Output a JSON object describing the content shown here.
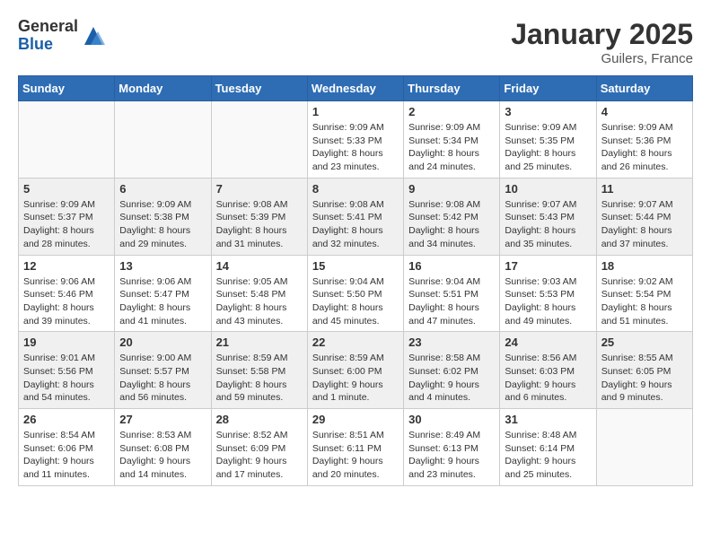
{
  "logo": {
    "general": "General",
    "blue": "Blue"
  },
  "title": "January 2025",
  "location": "Guilers, France",
  "weekdays": [
    "Sunday",
    "Monday",
    "Tuesday",
    "Wednesday",
    "Thursday",
    "Friday",
    "Saturday"
  ],
  "weeks": [
    [
      {
        "day": "",
        "info": ""
      },
      {
        "day": "",
        "info": ""
      },
      {
        "day": "",
        "info": ""
      },
      {
        "day": "1",
        "info": "Sunrise: 9:09 AM\nSunset: 5:33 PM\nDaylight: 8 hours and 23 minutes."
      },
      {
        "day": "2",
        "info": "Sunrise: 9:09 AM\nSunset: 5:34 PM\nDaylight: 8 hours and 24 minutes."
      },
      {
        "day": "3",
        "info": "Sunrise: 9:09 AM\nSunset: 5:35 PM\nDaylight: 8 hours and 25 minutes."
      },
      {
        "day": "4",
        "info": "Sunrise: 9:09 AM\nSunset: 5:36 PM\nDaylight: 8 hours and 26 minutes."
      }
    ],
    [
      {
        "day": "5",
        "info": "Sunrise: 9:09 AM\nSunset: 5:37 PM\nDaylight: 8 hours and 28 minutes."
      },
      {
        "day": "6",
        "info": "Sunrise: 9:09 AM\nSunset: 5:38 PM\nDaylight: 8 hours and 29 minutes."
      },
      {
        "day": "7",
        "info": "Sunrise: 9:08 AM\nSunset: 5:39 PM\nDaylight: 8 hours and 31 minutes."
      },
      {
        "day": "8",
        "info": "Sunrise: 9:08 AM\nSunset: 5:41 PM\nDaylight: 8 hours and 32 minutes."
      },
      {
        "day": "9",
        "info": "Sunrise: 9:08 AM\nSunset: 5:42 PM\nDaylight: 8 hours and 34 minutes."
      },
      {
        "day": "10",
        "info": "Sunrise: 9:07 AM\nSunset: 5:43 PM\nDaylight: 8 hours and 35 minutes."
      },
      {
        "day": "11",
        "info": "Sunrise: 9:07 AM\nSunset: 5:44 PM\nDaylight: 8 hours and 37 minutes."
      }
    ],
    [
      {
        "day": "12",
        "info": "Sunrise: 9:06 AM\nSunset: 5:46 PM\nDaylight: 8 hours and 39 minutes."
      },
      {
        "day": "13",
        "info": "Sunrise: 9:06 AM\nSunset: 5:47 PM\nDaylight: 8 hours and 41 minutes."
      },
      {
        "day": "14",
        "info": "Sunrise: 9:05 AM\nSunset: 5:48 PM\nDaylight: 8 hours and 43 minutes."
      },
      {
        "day": "15",
        "info": "Sunrise: 9:04 AM\nSunset: 5:50 PM\nDaylight: 8 hours and 45 minutes."
      },
      {
        "day": "16",
        "info": "Sunrise: 9:04 AM\nSunset: 5:51 PM\nDaylight: 8 hours and 47 minutes."
      },
      {
        "day": "17",
        "info": "Sunrise: 9:03 AM\nSunset: 5:53 PM\nDaylight: 8 hours and 49 minutes."
      },
      {
        "day": "18",
        "info": "Sunrise: 9:02 AM\nSunset: 5:54 PM\nDaylight: 8 hours and 51 minutes."
      }
    ],
    [
      {
        "day": "19",
        "info": "Sunrise: 9:01 AM\nSunset: 5:56 PM\nDaylight: 8 hours and 54 minutes."
      },
      {
        "day": "20",
        "info": "Sunrise: 9:00 AM\nSunset: 5:57 PM\nDaylight: 8 hours and 56 minutes."
      },
      {
        "day": "21",
        "info": "Sunrise: 8:59 AM\nSunset: 5:58 PM\nDaylight: 8 hours and 59 minutes."
      },
      {
        "day": "22",
        "info": "Sunrise: 8:59 AM\nSunset: 6:00 PM\nDaylight: 9 hours and 1 minute."
      },
      {
        "day": "23",
        "info": "Sunrise: 8:58 AM\nSunset: 6:02 PM\nDaylight: 9 hours and 4 minutes."
      },
      {
        "day": "24",
        "info": "Sunrise: 8:56 AM\nSunset: 6:03 PM\nDaylight: 9 hours and 6 minutes."
      },
      {
        "day": "25",
        "info": "Sunrise: 8:55 AM\nSunset: 6:05 PM\nDaylight: 9 hours and 9 minutes."
      }
    ],
    [
      {
        "day": "26",
        "info": "Sunrise: 8:54 AM\nSunset: 6:06 PM\nDaylight: 9 hours and 11 minutes."
      },
      {
        "day": "27",
        "info": "Sunrise: 8:53 AM\nSunset: 6:08 PM\nDaylight: 9 hours and 14 minutes."
      },
      {
        "day": "28",
        "info": "Sunrise: 8:52 AM\nSunset: 6:09 PM\nDaylight: 9 hours and 17 minutes."
      },
      {
        "day": "29",
        "info": "Sunrise: 8:51 AM\nSunset: 6:11 PM\nDaylight: 9 hours and 20 minutes."
      },
      {
        "day": "30",
        "info": "Sunrise: 8:49 AM\nSunset: 6:13 PM\nDaylight: 9 hours and 23 minutes."
      },
      {
        "day": "31",
        "info": "Sunrise: 8:48 AM\nSunset: 6:14 PM\nDaylight: 9 hours and 25 minutes."
      },
      {
        "day": "",
        "info": ""
      }
    ]
  ]
}
